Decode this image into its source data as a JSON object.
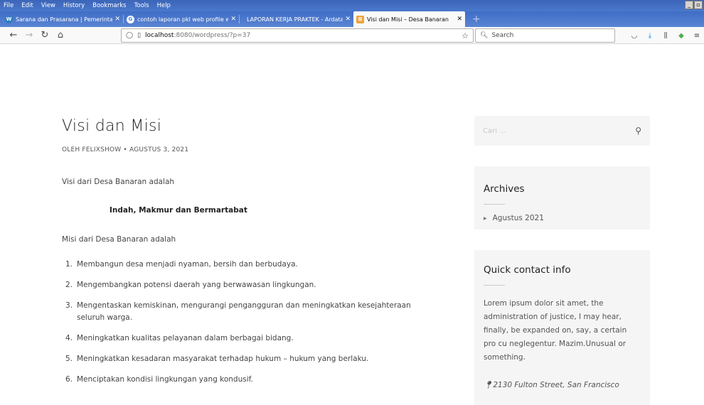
{
  "menubar": {
    "items": [
      "File",
      "Edit",
      "View",
      "History",
      "Bookmarks",
      "Tools",
      "Help"
    ]
  },
  "tabs": [
    {
      "title": "Sarana dan Prasarana | Pemerintal",
      "icon": "wordpress-icon",
      "color": "#2a7fc1",
      "active": false
    },
    {
      "title": "contoh laporan pkl web profile wor",
      "icon": "google-icon",
      "color": "#ffffff",
      "active": false
    },
    {
      "title": "LAPORAN KERJA PRAKTEK - Ardata Ind",
      "icon": "none",
      "color": "",
      "active": false
    },
    {
      "title": "Visi dan Misi – Desa Banaran",
      "icon": "site-icon",
      "color": "#f0a13a",
      "active": true
    }
  ],
  "navbar": {
    "url_host": "localhost",
    "url_path": ":8080/wordpress/?p=37",
    "search_placeholder": "Search"
  },
  "post": {
    "title": "Visi dan Misi",
    "meta": "OLEH FELIXSHOW • AGUSTUS 3, 2021",
    "vision_intro": "Visi dari Desa Banaran adalah",
    "vision": "Indah, Makmur dan Bermartabat",
    "mission_intro": "Misi dari Desa Banaran adalah",
    "missions": [
      {
        "num": "1.",
        "text": "Membangun desa menjadi nyaman, bersih dan berbudaya."
      },
      {
        "num": "2.",
        "text": "Mengembangkan potensi daerah yang berwawasan lingkungan."
      },
      {
        "num": "3.",
        "text": "Mengentaskan kemiskinan, mengurangi pengangguran dan meningkatkan kesejahteraan seluruh warga."
      },
      {
        "num": "4.",
        "text": "Meningkatkan kualitas pelayanan dalam berbagai bidang."
      },
      {
        "num": "5.",
        "text": "Meningkatkan kesadaran masyarakat terhadap hukum – hukum yang berlaku."
      },
      {
        "num": "6.",
        "text": "Menciptakan kondisi lingkungan yang kondusif."
      }
    ]
  },
  "sidebar": {
    "search_placeholder": "Cari …",
    "archives_title": "Archives",
    "archive_item": "Agustus 2021",
    "contact_title": "Quick contact info",
    "contact_text": "Lorem ipsum dolor sit amet, the administration of justice, I may hear, finally, be expanded on, say, a certain pro cu neglegentur. Mazim.Unusual or something.",
    "address": "2130 Fulton Street, San Francisco"
  }
}
